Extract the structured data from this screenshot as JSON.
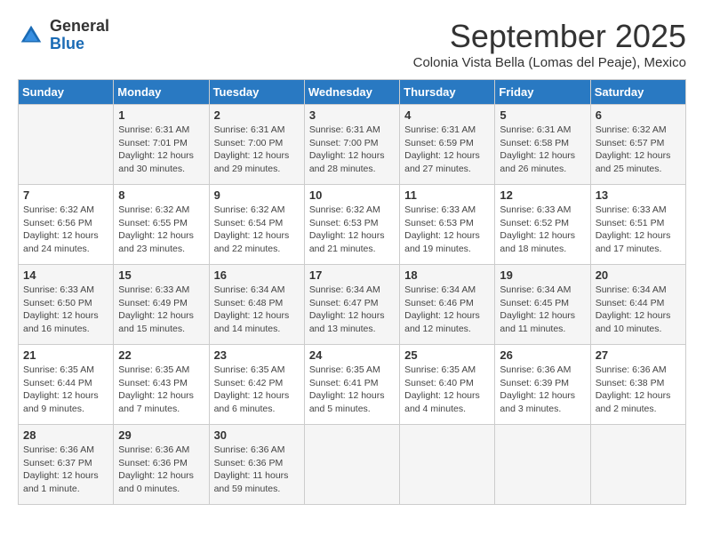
{
  "logo": {
    "general": "General",
    "blue": "Blue"
  },
  "title": "September 2025",
  "location": "Colonia Vista Bella (Lomas del Peaje), Mexico",
  "days_of_week": [
    "Sunday",
    "Monday",
    "Tuesday",
    "Wednesday",
    "Thursday",
    "Friday",
    "Saturday"
  ],
  "weeks": [
    [
      {
        "day": "",
        "info": ""
      },
      {
        "day": "1",
        "info": "Sunrise: 6:31 AM\nSunset: 7:01 PM\nDaylight: 12 hours\nand 30 minutes."
      },
      {
        "day": "2",
        "info": "Sunrise: 6:31 AM\nSunset: 7:00 PM\nDaylight: 12 hours\nand 29 minutes."
      },
      {
        "day": "3",
        "info": "Sunrise: 6:31 AM\nSunset: 7:00 PM\nDaylight: 12 hours\nand 28 minutes."
      },
      {
        "day": "4",
        "info": "Sunrise: 6:31 AM\nSunset: 6:59 PM\nDaylight: 12 hours\nand 27 minutes."
      },
      {
        "day": "5",
        "info": "Sunrise: 6:31 AM\nSunset: 6:58 PM\nDaylight: 12 hours\nand 26 minutes."
      },
      {
        "day": "6",
        "info": "Sunrise: 6:32 AM\nSunset: 6:57 PM\nDaylight: 12 hours\nand 25 minutes."
      }
    ],
    [
      {
        "day": "7",
        "info": "Sunrise: 6:32 AM\nSunset: 6:56 PM\nDaylight: 12 hours\nand 24 minutes."
      },
      {
        "day": "8",
        "info": "Sunrise: 6:32 AM\nSunset: 6:55 PM\nDaylight: 12 hours\nand 23 minutes."
      },
      {
        "day": "9",
        "info": "Sunrise: 6:32 AM\nSunset: 6:54 PM\nDaylight: 12 hours\nand 22 minutes."
      },
      {
        "day": "10",
        "info": "Sunrise: 6:32 AM\nSunset: 6:53 PM\nDaylight: 12 hours\nand 21 minutes."
      },
      {
        "day": "11",
        "info": "Sunrise: 6:33 AM\nSunset: 6:53 PM\nDaylight: 12 hours\nand 19 minutes."
      },
      {
        "day": "12",
        "info": "Sunrise: 6:33 AM\nSunset: 6:52 PM\nDaylight: 12 hours\nand 18 minutes."
      },
      {
        "day": "13",
        "info": "Sunrise: 6:33 AM\nSunset: 6:51 PM\nDaylight: 12 hours\nand 17 minutes."
      }
    ],
    [
      {
        "day": "14",
        "info": "Sunrise: 6:33 AM\nSunset: 6:50 PM\nDaylight: 12 hours\nand 16 minutes."
      },
      {
        "day": "15",
        "info": "Sunrise: 6:33 AM\nSunset: 6:49 PM\nDaylight: 12 hours\nand 15 minutes."
      },
      {
        "day": "16",
        "info": "Sunrise: 6:34 AM\nSunset: 6:48 PM\nDaylight: 12 hours\nand 14 minutes."
      },
      {
        "day": "17",
        "info": "Sunrise: 6:34 AM\nSunset: 6:47 PM\nDaylight: 12 hours\nand 13 minutes."
      },
      {
        "day": "18",
        "info": "Sunrise: 6:34 AM\nSunset: 6:46 PM\nDaylight: 12 hours\nand 12 minutes."
      },
      {
        "day": "19",
        "info": "Sunrise: 6:34 AM\nSunset: 6:45 PM\nDaylight: 12 hours\nand 11 minutes."
      },
      {
        "day": "20",
        "info": "Sunrise: 6:34 AM\nSunset: 6:44 PM\nDaylight: 12 hours\nand 10 minutes."
      }
    ],
    [
      {
        "day": "21",
        "info": "Sunrise: 6:35 AM\nSunset: 6:44 PM\nDaylight: 12 hours\nand 9 minutes."
      },
      {
        "day": "22",
        "info": "Sunrise: 6:35 AM\nSunset: 6:43 PM\nDaylight: 12 hours\nand 7 minutes."
      },
      {
        "day": "23",
        "info": "Sunrise: 6:35 AM\nSunset: 6:42 PM\nDaylight: 12 hours\nand 6 minutes."
      },
      {
        "day": "24",
        "info": "Sunrise: 6:35 AM\nSunset: 6:41 PM\nDaylight: 12 hours\nand 5 minutes."
      },
      {
        "day": "25",
        "info": "Sunrise: 6:35 AM\nSunset: 6:40 PM\nDaylight: 12 hours\nand 4 minutes."
      },
      {
        "day": "26",
        "info": "Sunrise: 6:36 AM\nSunset: 6:39 PM\nDaylight: 12 hours\nand 3 minutes."
      },
      {
        "day": "27",
        "info": "Sunrise: 6:36 AM\nSunset: 6:38 PM\nDaylight: 12 hours\nand 2 minutes."
      }
    ],
    [
      {
        "day": "28",
        "info": "Sunrise: 6:36 AM\nSunset: 6:37 PM\nDaylight: 12 hours\nand 1 minute."
      },
      {
        "day": "29",
        "info": "Sunrise: 6:36 AM\nSunset: 6:36 PM\nDaylight: 12 hours\nand 0 minutes."
      },
      {
        "day": "30",
        "info": "Sunrise: 6:36 AM\nSunset: 6:36 PM\nDaylight: 11 hours\nand 59 minutes."
      },
      {
        "day": "",
        "info": ""
      },
      {
        "day": "",
        "info": ""
      },
      {
        "day": "",
        "info": ""
      },
      {
        "day": "",
        "info": ""
      }
    ]
  ]
}
